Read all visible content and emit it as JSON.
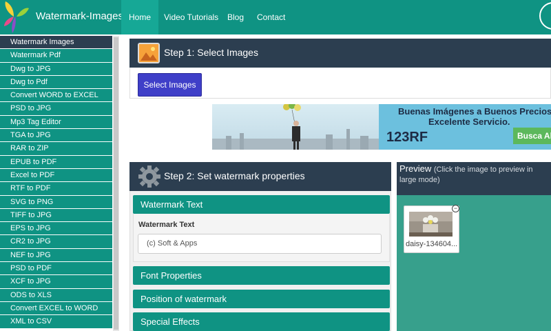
{
  "header": {
    "brand": "Watermark-Images",
    "nav": [
      {
        "label": "Home",
        "active": true
      },
      {
        "label": "Video Tutorials"
      },
      {
        "label": "Blog"
      },
      {
        "label": "Contact"
      }
    ]
  },
  "sidebar": {
    "items": [
      {
        "label": "Watermark Images",
        "active": true
      },
      {
        "label": "Watermark Pdf"
      },
      {
        "label": "Dwg to JPG"
      },
      {
        "label": "Dwg to Pdf"
      },
      {
        "label": "Convert WORD to EXCEL"
      },
      {
        "label": "PSD to JPG"
      },
      {
        "label": "Mp3 Tag Editor"
      },
      {
        "label": "TGA to JPG"
      },
      {
        "label": "RAR to ZIP"
      },
      {
        "label": "EPUB to PDF"
      },
      {
        "label": "Excel to PDF"
      },
      {
        "label": "RTF to PDF"
      },
      {
        "label": "SVG to PNG"
      },
      {
        "label": "TIFF to JPG"
      },
      {
        "label": "EPS to JPG"
      },
      {
        "label": "CR2 to JPG"
      },
      {
        "label": "NEF to JPG"
      },
      {
        "label": "PSD to PDF"
      },
      {
        "label": "XCF to JPG"
      },
      {
        "label": "ODS to XLS"
      },
      {
        "label": "Convert EXCEL to WORD"
      },
      {
        "label": "XML to CSV"
      }
    ]
  },
  "step1": {
    "title": "Step 1: Select Images",
    "button": "Select Images"
  },
  "ad": {
    "line1": "Buenas Imágenes a Buenos Precios",
    "line2": "Excelente Servicio.",
    "logo": "123RF",
    "button": "Busca Ahora"
  },
  "step2": {
    "title": "Step 2: Set watermark properties",
    "sections": {
      "watermark_text": "Watermark Text",
      "font_properties": "Font Properties",
      "position": "Position of watermark",
      "special_effects": "Special Effects"
    },
    "field_label": "Watermark Text",
    "field_value": "(c) Soft & Apps"
  },
  "preview": {
    "title": "Preview",
    "note": "(Click the image to preview in large mode)",
    "thumbnail_name": "daisy-134604...",
    "close_glyph": "−"
  },
  "colors": {
    "primary": "#0f9383",
    "dark": "#2c3e50",
    "button": "#3f3fc8",
    "preview_bg": "#37a08c"
  }
}
